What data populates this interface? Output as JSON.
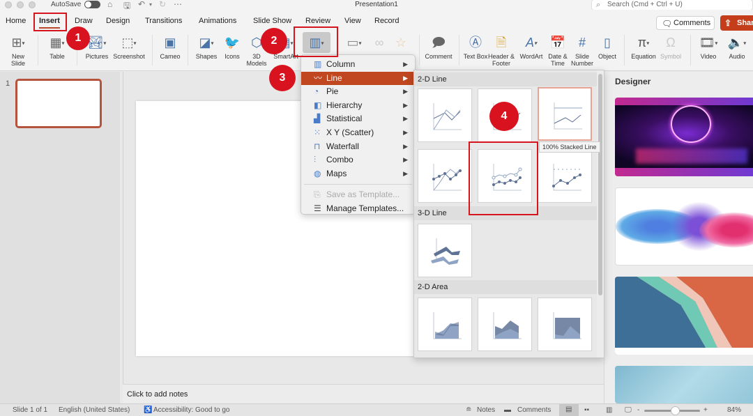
{
  "titlebar": {
    "autosave_label": "AutoSave",
    "doc_title": "Presentation1",
    "search_placeholder": "Search (Cmd + Ctrl + U)",
    "quick_access": [
      "home-icon",
      "save-icon",
      "undo-icon",
      "redo-icon",
      "more-icon"
    ]
  },
  "tabs": [
    {
      "label": "Home"
    },
    {
      "label": "Insert",
      "active": true
    },
    {
      "label": "Draw"
    },
    {
      "label": "Design"
    },
    {
      "label": "Transitions"
    },
    {
      "label": "Animations"
    },
    {
      "label": "Slide Show"
    },
    {
      "label": "Review"
    },
    {
      "label": "View"
    },
    {
      "label": "Record"
    }
  ],
  "header_buttons": {
    "comments": "Comments",
    "share": "Share"
  },
  "ribbon": {
    "new_slide": "New Slide",
    "table": "Table",
    "pictures": "Pictures",
    "screenshot": "Screenshot",
    "cameo": "Cameo",
    "shapes": "Shapes",
    "icons": "Icons",
    "models_3d": "3D Models",
    "smartart": "SmartArt",
    "comment": "Comment",
    "text_box": "Text Box",
    "header_footer": "Header & Footer",
    "wordart": "WordArt",
    "date_time": "Date & Time",
    "slide_number": "Slide Number",
    "object": "Object",
    "equation": "Equation",
    "symbol": "Symbol",
    "video": "Video",
    "audio": "Audio"
  },
  "thumbnails": {
    "slide_number": "1"
  },
  "notes_placeholder": "Click to add notes",
  "designer": {
    "title": "Designer"
  },
  "chart_menu": {
    "items": [
      {
        "label": "Column",
        "icon": "column-chart-icon"
      },
      {
        "label": "Line",
        "icon": "line-chart-icon",
        "active": true
      },
      {
        "label": "Pie",
        "icon": "pie-chart-icon"
      },
      {
        "label": "Hierarchy",
        "icon": "hierarchy-chart-icon"
      },
      {
        "label": "Statistical",
        "icon": "statistical-chart-icon"
      },
      {
        "label": "X Y (Scatter)",
        "icon": "scatter-chart-icon"
      },
      {
        "label": "Waterfall",
        "icon": "waterfall-chart-icon"
      },
      {
        "label": "Combo",
        "icon": "combo-chart-icon"
      },
      {
        "label": "Maps",
        "icon": "maps-chart-icon"
      }
    ],
    "save_template": "Save as Template...",
    "manage_templates": "Manage Templates..."
  },
  "gallery": {
    "sections": [
      "2-D Line",
      "3-D Line",
      "2-D Area"
    ],
    "tooltip": "100% Stacked Line"
  },
  "statusbar": {
    "slide_info": "Slide 1 of 1",
    "language": "English (United States)",
    "accessibility": "Accessibility: Good to go",
    "notes": "Notes",
    "comments": "Comments",
    "zoom_minus": "-",
    "zoom_plus": "+",
    "zoom_level": "84%",
    "zoom_fraction": 0.55
  },
  "annotations": [
    "1",
    "2",
    "3",
    "4"
  ],
  "colors": {
    "accent": "#c43e1c",
    "menu_highlight": "#c0471f",
    "annotation_red": "#d8121f"
  }
}
